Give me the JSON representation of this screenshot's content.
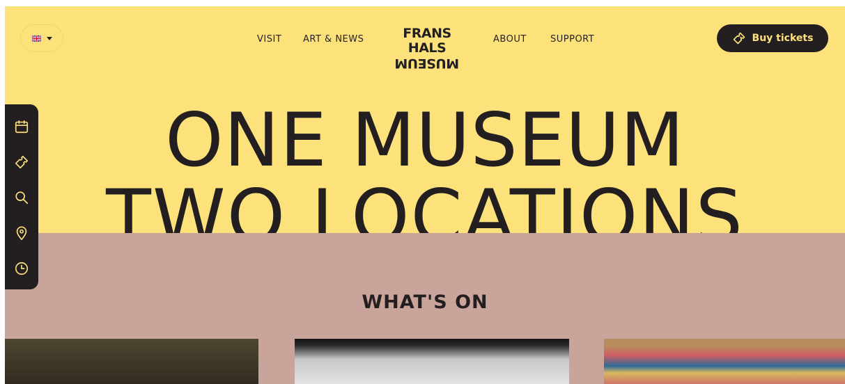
{
  "header": {
    "language_flag_icon": "uk-flag-icon",
    "language_caret_icon": "caret-down-icon",
    "nav": [
      {
        "label": "VISIT"
      },
      {
        "label": "ART & NEWS"
      },
      {
        "label": "ABOUT"
      },
      {
        "label": "SUPPORT"
      }
    ],
    "logo": {
      "line1": "FRANS HALS",
      "line2": "MUSEUM"
    },
    "cta": {
      "label": "Buy tickets",
      "icon": "ticket-icon"
    }
  },
  "hero": {
    "line1": "ONE MUSEUM",
    "line2": "TWO LOCATIONS"
  },
  "sidebar": {
    "icons": [
      "calendar-icon",
      "ticket-icon",
      "search-icon",
      "location-pin-icon",
      "clock-icon"
    ]
  },
  "section": {
    "title": "WHAT'S ON"
  },
  "colors": {
    "hero_bg": "#fde27c",
    "section_bg": "#c9a49b",
    "dark": "#231f20"
  }
}
